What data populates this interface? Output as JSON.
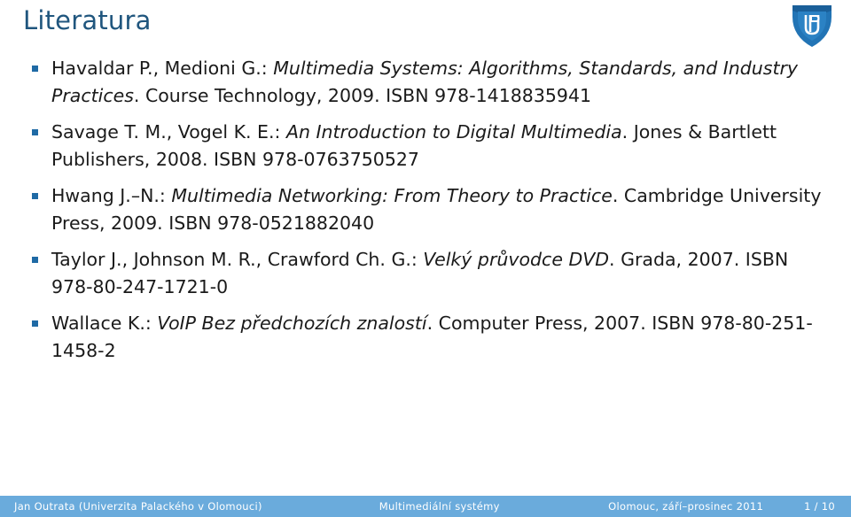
{
  "slide": {
    "title": "Literatura",
    "logo_name": "up-shield-logo",
    "accent_color": "#20567e",
    "bullet_color": "#1f6aa5",
    "footer_bar_color": "#6aabdc",
    "text_color": "#1a1a1a"
  },
  "bibliography": [
    {
      "authors": "Havaldar P., Medioni G.: ",
      "work_title": "Multimedia Systems: Algorithms, Standards, and Industry Practices",
      "publication": ". Course Technology, 2009. ISBN 978-1418835941"
    },
    {
      "authors": "Savage T. M., Vogel K. E.: ",
      "work_title": "An Introduction to Digital Multimedia",
      "publication": ". Jones & Bartlett Publishers, 2008. ISBN 978-0763750527"
    },
    {
      "authors": "Hwang J.–N.: ",
      "work_title": "Multimedia Networking: From Theory to Practice",
      "publication": ". Cambridge University Press, 2009. ISBN 978-0521882040"
    },
    {
      "authors": "Taylor J., Johnson M. R., Crawford Ch. G.: ",
      "work_title": "Velký průvodce DVD",
      "publication": ". Grada, 2007. ISBN 978-80-247-1721-0"
    },
    {
      "authors": "Wallace K.: ",
      "work_title": "VoIP Bez předchozích znalostí",
      "publication": ". Computer Press, 2007. ISBN 978-80-251-1458-2"
    }
  ],
  "footer": {
    "author": "Jan Outrata (Univerzita Palackého v Olomouci)",
    "subject": "Multimediální systémy",
    "date": "Olomouc, září–prosinec 2011",
    "page": "1 / 10"
  }
}
